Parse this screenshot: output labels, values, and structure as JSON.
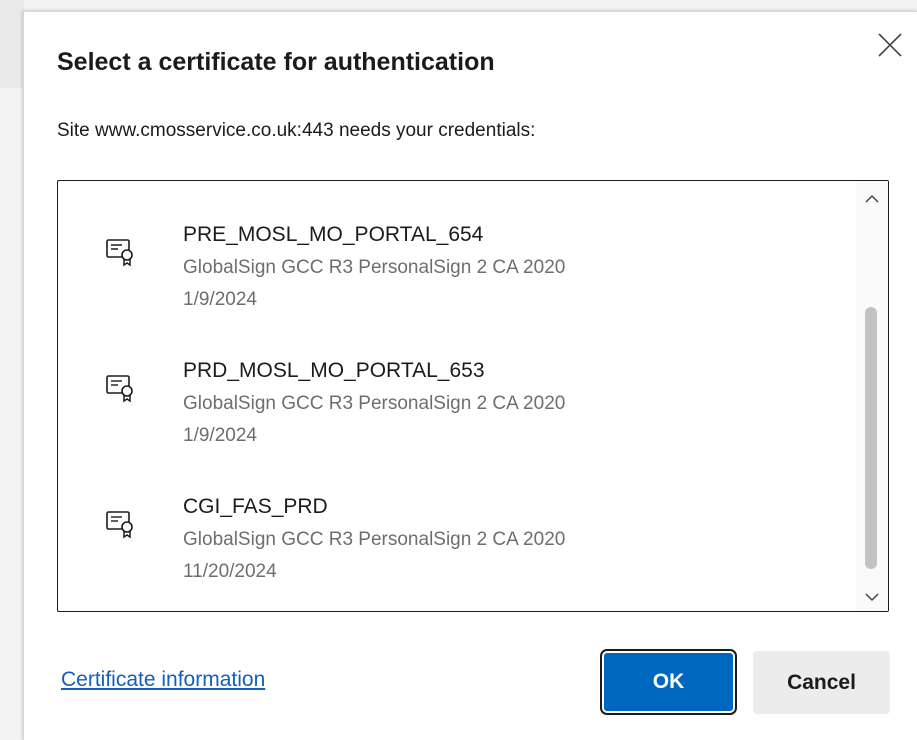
{
  "dialog": {
    "title": "Select a certificate for authentication",
    "subtitle": "Site www.cmosservice.co.uk:443 needs your credentials:",
    "close_icon": "close-icon"
  },
  "certificates": [
    {
      "name": "PRE_MOSL_MO_PORTAL_654",
      "issuer": "GlobalSign GCC R3 PersonalSign 2 CA 2020",
      "date": "1/9/2024",
      "icon": "certificate-icon"
    },
    {
      "name": "PRD_MOSL_MO_PORTAL_653",
      "issuer": "GlobalSign GCC R3 PersonalSign 2 CA 2020",
      "date": "1/9/2024",
      "icon": "certificate-icon"
    },
    {
      "name": "CGI_FAS_PRD",
      "issuer": "GlobalSign GCC R3 PersonalSign 2 CA 2020",
      "date": "11/20/2024",
      "icon": "certificate-icon"
    }
  ],
  "footer": {
    "cert_info_link": "Certificate information",
    "ok_label": "OK",
    "cancel_label": "Cancel"
  },
  "colors": {
    "accent": "#0067c0",
    "link": "#1260b8",
    "secondary_text": "#6e6e6e"
  }
}
